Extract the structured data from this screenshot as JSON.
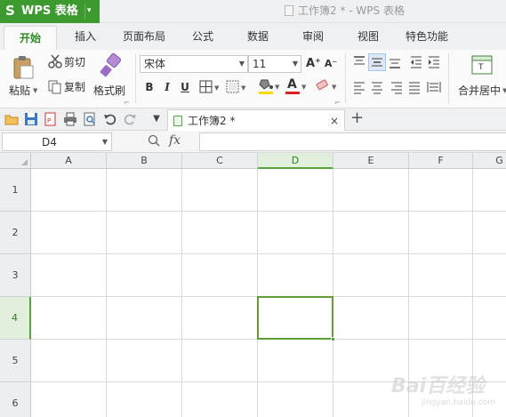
{
  "app": {
    "logo": "S",
    "name": "WPS 表格",
    "caret": "▾"
  },
  "window_title": "工作簿2 * - WPS 表格",
  "tabs": [
    {
      "label": "开始"
    },
    {
      "label": "插入"
    },
    {
      "label": "页面布局"
    },
    {
      "label": "公式"
    },
    {
      "label": "数据"
    },
    {
      "label": "审阅"
    },
    {
      "label": "视图"
    },
    {
      "label": "特色功能"
    }
  ],
  "ribbon": {
    "paste_label": "粘贴",
    "cut_label": "剪切",
    "copy_label": "复制",
    "format_painter_label": "格式刷",
    "font_name": "宋体",
    "font_size": "11",
    "grow_font": "A⁺",
    "shrink_font": "A⁻",
    "bold": "B",
    "italic": "I",
    "underline": "U",
    "font_color_glyph": "A",
    "merge_center_label": "合并居中",
    "merge_caret": "▾"
  },
  "colors": {
    "accent": "#3c9a2f",
    "selection": "#5d9e35",
    "font_color_bar": "#e02020",
    "fill_color_bar": "#ffd800"
  },
  "doc_tab": {
    "label": "工作簿2 *",
    "close": "×",
    "new_tab": "+"
  },
  "formula_bar": {
    "cell_ref": "D4",
    "fx": "fx",
    "value": ""
  },
  "sheet": {
    "columns": [
      "A",
      "B",
      "C",
      "D",
      "E",
      "F",
      "G"
    ],
    "rows": [
      "1",
      "2",
      "3",
      "4",
      "5",
      "6"
    ],
    "selected_column": "D",
    "selected_row": "4"
  },
  "watermark": {
    "line1": "Bai百经验",
    "line2": "jingyan.baidu.com"
  }
}
